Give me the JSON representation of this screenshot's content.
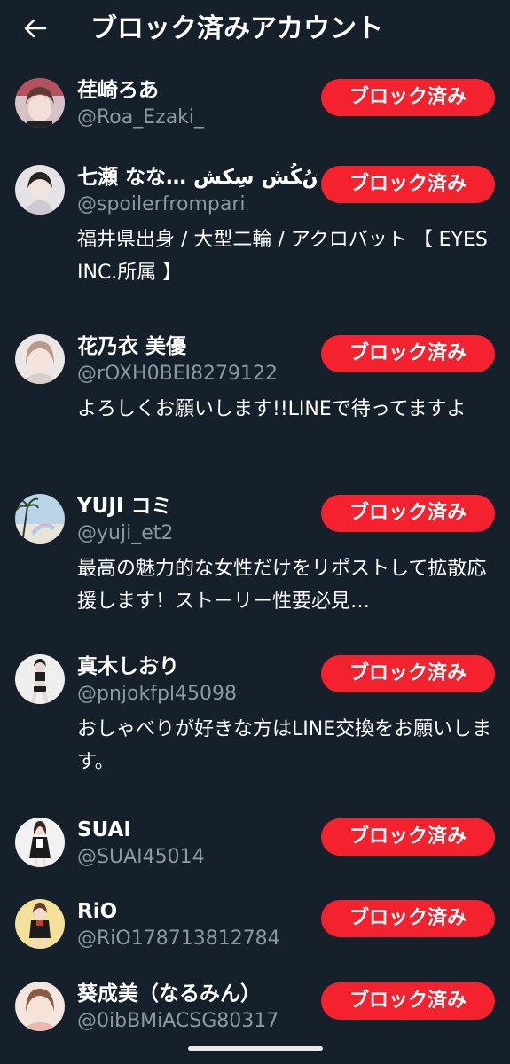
{
  "header": {
    "back_icon": "arrow-left-icon",
    "title": "ブロック済みアカウント"
  },
  "colors": {
    "background": "#15202b",
    "accent": "#f4212e",
    "secondary_text": "#8b98a5"
  },
  "accounts": [
    {
      "name": "荏崎ろあ",
      "handle": "@Roa_Ezaki_",
      "bio": "",
      "button_label": "ブロック済み"
    },
    {
      "name": "七瀬 なな… ﺵُﮑُﺶ ﺳِﮑﺶ",
      "handle": "@spoilerfrompari",
      "bio": "福井県出身 / 大型二輪 / アクロバット 【 EYES INC.所属 】",
      "button_label": "ブロック済み"
    },
    {
      "name": "花乃衣 美優",
      "handle": "@rOXH0BEI8279122",
      "bio": "よろしくお願いします!!LINEで待ってますよ",
      "button_label": "ブロック済み"
    },
    {
      "name": "YUJI コミ",
      "handle": "@yuji_et2",
      "bio": "最高の魅力的な女性だけをリポストして拡散応援します！ストーリー性要必見…",
      "button_label": "ブロック済み"
    },
    {
      "name": "真木しおり",
      "handle": "@pnjokfpl45098",
      "bio": "おしゃべりが好きな方はLINE交換をお願いします。",
      "button_label": "ブロック済み"
    },
    {
      "name": "SUAI",
      "handle": "@SUAI45014",
      "bio": "",
      "button_label": "ブロック済み"
    },
    {
      "name": "RiO",
      "handle": "@RiO178713812784",
      "bio": "",
      "button_label": "ブロック済み"
    },
    {
      "name": "葵成美（なるみん）",
      "handle": "@0ibBMiACSG80317",
      "bio": "",
      "button_label": "ブロック済み"
    }
  ]
}
